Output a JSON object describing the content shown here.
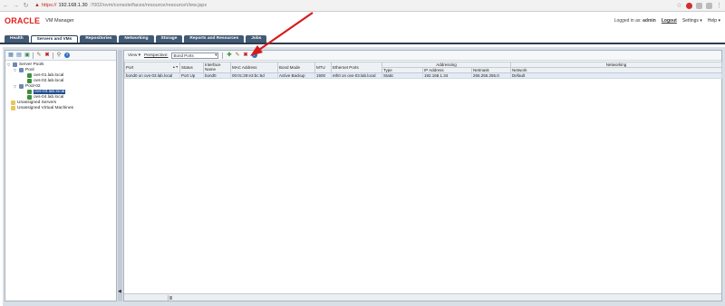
{
  "browser": {
    "url_https": "https://",
    "url_host": "192.168.1.30",
    "url_path": ":7002/ovm/console/faces/resource/resourceView.jspx"
  },
  "app": {
    "logo": "ORACLE",
    "product": "VM Manager",
    "logged_in_label": "Logged in as:",
    "user": "admin",
    "logout": "Logout",
    "settings": "Settings",
    "help": "Help"
  },
  "tabs": [
    {
      "label": "Health"
    },
    {
      "label": "Servers and VMs"
    },
    {
      "label": "Repositories"
    },
    {
      "label": "Networking"
    },
    {
      "label": "Storage"
    },
    {
      "label": "Reports and Resources"
    },
    {
      "label": "Jobs"
    }
  ],
  "tree": {
    "server_pools": "Server Pools",
    "pool1": "Pool",
    "pool1_servers": [
      "ovs-01.lab.local",
      "ovs-02.lab.local"
    ],
    "pool2": "Pool-02",
    "pool2_servers": [
      "ovs-03.lab.local",
      "ovs-04.lab.local"
    ],
    "unassigned_servers": "Unassigned Servers",
    "unassigned_vms": "Unassigned Virtual Machines"
  },
  "toolbar": {
    "view": "View",
    "perspective_label": "Perspective:",
    "perspective_value": "Bond Ports"
  },
  "table": {
    "group_headers": {
      "addressing": "Addressing",
      "networking": "Networking"
    },
    "columns": {
      "port": "Port",
      "status": "Status",
      "interface_name": "Interface Name",
      "mac": "MAC Address",
      "bond_mode": "Bond Mode",
      "mtu": "MTU",
      "ethernet_ports": "Ethernet Ports",
      "type": "Type",
      "ip": "IP Address",
      "netmask": "Netmask",
      "network": "Network"
    },
    "rows": [
      {
        "port": "bond0 on ovs-03.lab.local",
        "status": "Port Up",
        "interface_name": "bond0",
        "mac": "00:0c:29:e3:bc:6d",
        "bond_mode": "Active Backup",
        "mtu": "1500",
        "ethernet_ports": "eth0 on ovs-03.lab.local",
        "type": "Static",
        "ip": "192.168.1.34",
        "netmask": "255.255.255.0",
        "network": "Default"
      }
    ]
  },
  "colors": {
    "accent": "#e01b1b",
    "tab_bg": "#435a74",
    "selected": "#1f4d8f"
  }
}
